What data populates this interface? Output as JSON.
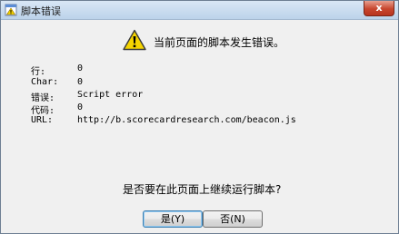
{
  "window": {
    "title": "脚本错误",
    "close_label": "x"
  },
  "header": {
    "message": "当前页面的脚本发生错误。"
  },
  "details": [
    {
      "label": "行:",
      "value": "0"
    },
    {
      "label": "Char:",
      "value": "0"
    },
    {
      "label": "错误:",
      "value": "Script error"
    },
    {
      "label": "代码:",
      "value": "0"
    },
    {
      "label": "URL:",
      "value": "http://b.scorecardresearch.com/beacon.js"
    }
  ],
  "question": "是否要在此页面上继续运行脚本?",
  "buttons": {
    "yes_label": "是(Y)",
    "no_label": "否(N)"
  },
  "icons": {
    "title": "script-error-icon",
    "warning": "warning-icon",
    "close": "close-icon"
  },
  "colors": {
    "warning_fill": "#f5d400",
    "title_gradient_top": "#d9e7f5",
    "close_red": "#c7462e"
  }
}
